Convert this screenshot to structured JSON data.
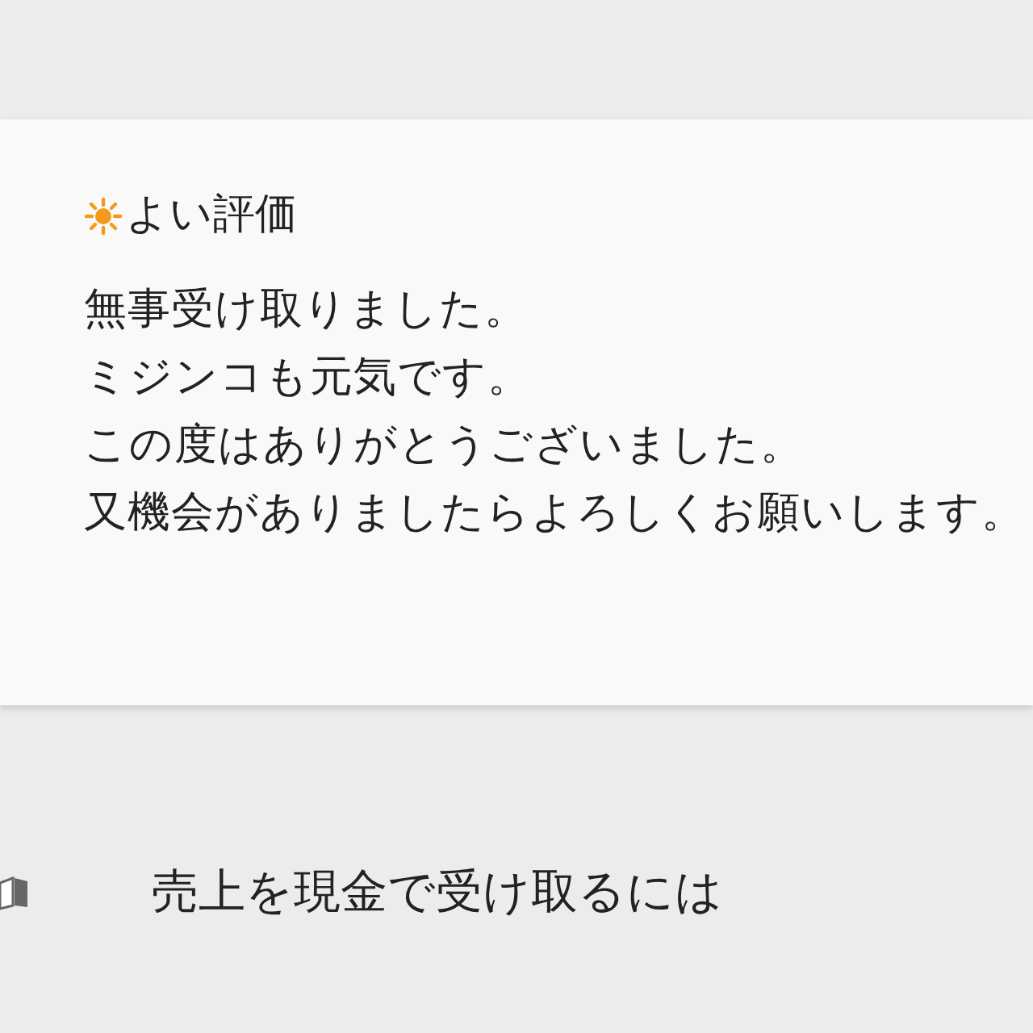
{
  "review": {
    "kind": "good",
    "rating_label": "よい評価",
    "lines": [
      "無事受け取りました。",
      "ミジンコも元気です。",
      "この度はありがとうございました。",
      "又機会がありましたらよろしくお願いします。"
    ]
  },
  "menu_items": [
    {
      "label": "売上を現金で受け取るには"
    }
  ]
}
